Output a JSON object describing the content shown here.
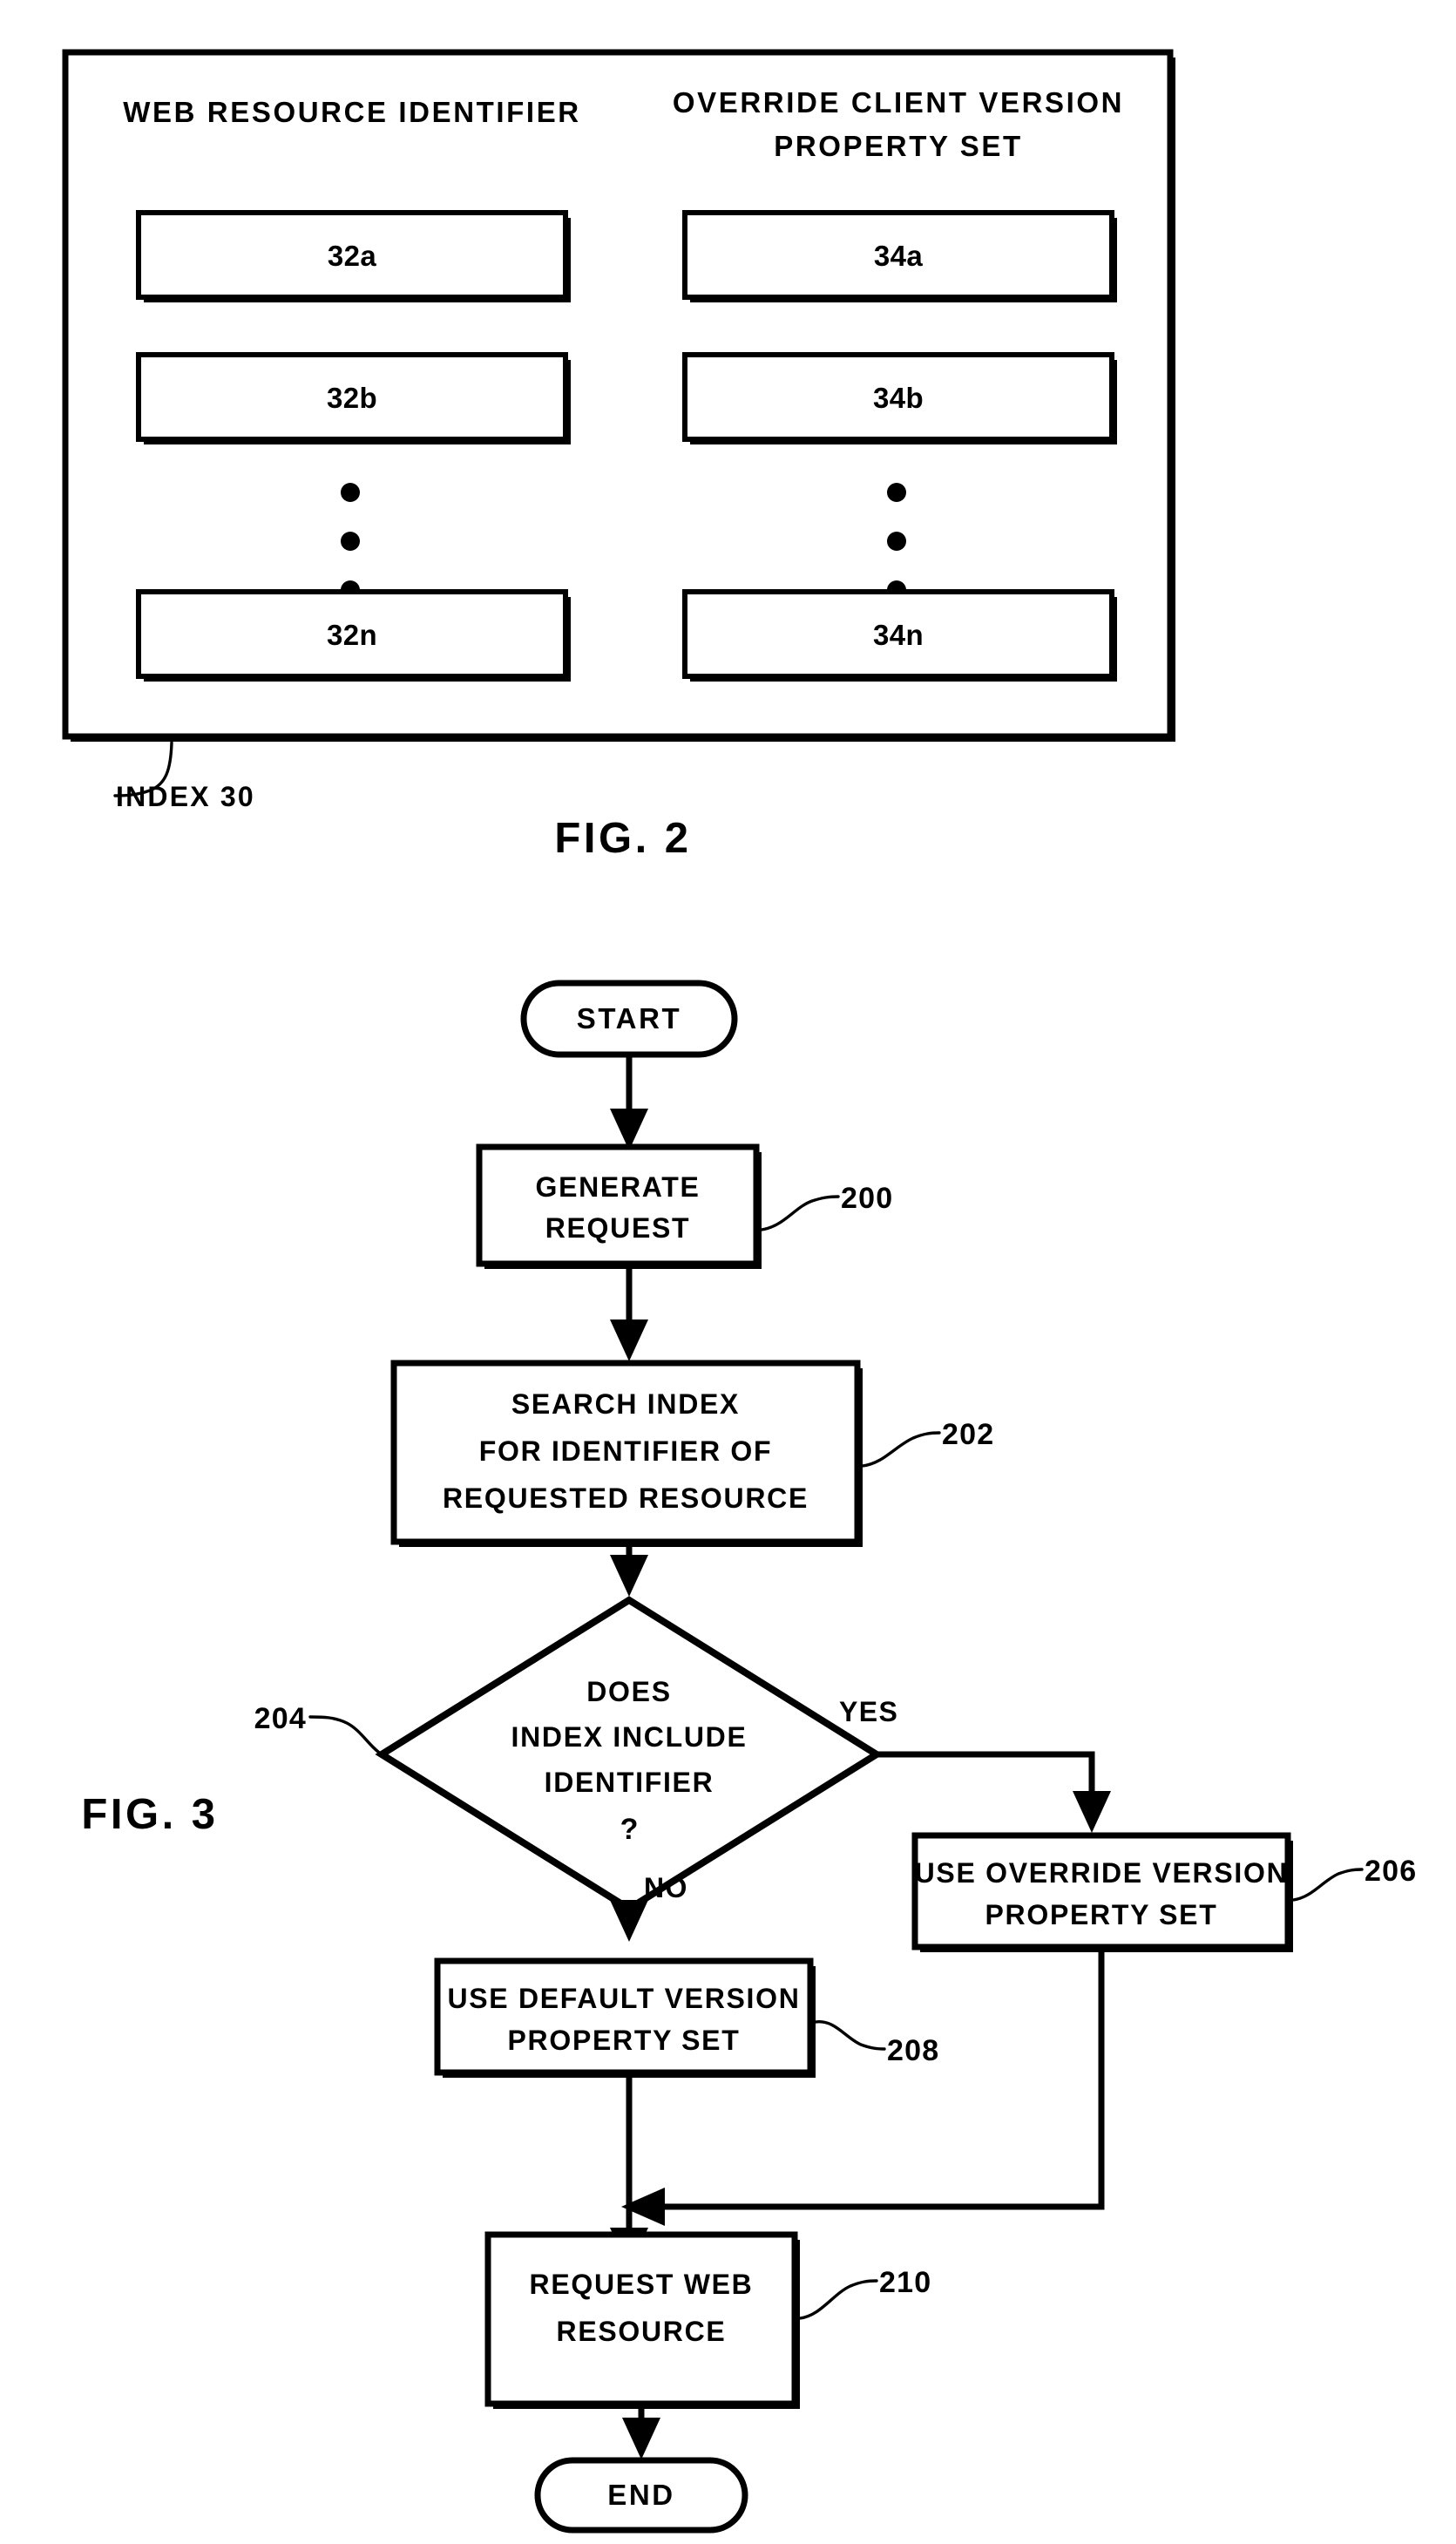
{
  "figures": [
    {
      "caption": "FIG. 2",
      "index_label": "INDEX 30",
      "columns": [
        {
          "header": "WEB RESOURCE IDENTIFIER",
          "header_lines": [
            "WEB RESOURCE IDENTIFIER"
          ],
          "cells": [
            "32a",
            "32b",
            "32n"
          ],
          "ellipsis": "vertical-three-dots"
        },
        {
          "header": "OVERRIDE CLIENT VERSION PROPERTY SET",
          "header_lines": [
            "OVERRIDE CLIENT VERSION",
            "PROPERTY SET"
          ],
          "cells": [
            "34a",
            "34b",
            "34n"
          ],
          "ellipsis": "vertical-three-dots"
        }
      ]
    },
    {
      "caption": "FIG. 3",
      "nodes": [
        {
          "id": "start",
          "shape": "terminator",
          "lines": [
            "START"
          ],
          "ref": ""
        },
        {
          "id": "n200",
          "shape": "process",
          "lines": [
            "GENERATE",
            "REQUEST"
          ],
          "ref": "200"
        },
        {
          "id": "n202",
          "shape": "process",
          "lines": [
            "SEARCH INDEX",
            "FOR IDENTIFIER OF",
            "REQUESTED RESOURCE"
          ],
          "ref": "202"
        },
        {
          "id": "n204",
          "shape": "decision",
          "lines": [
            "DOES",
            "INDEX INCLUDE",
            "IDENTIFIER",
            "?"
          ],
          "ref": "204"
        },
        {
          "id": "n206",
          "shape": "process",
          "lines": [
            "USE OVERRIDE VERSION",
            "PROPERTY SET"
          ],
          "ref": "206"
        },
        {
          "id": "n208",
          "shape": "process",
          "lines": [
            "USE DEFAULT VERSION",
            "PROPERTY SET"
          ],
          "ref": "208"
        },
        {
          "id": "n210",
          "shape": "process",
          "lines": [
            "REQUEST WEB",
            "RESOURCE"
          ],
          "ref": "210"
        },
        {
          "id": "end",
          "shape": "terminator",
          "lines": [
            "END"
          ],
          "ref": ""
        }
      ],
      "branch_labels": {
        "yes": "YES",
        "no": "NO"
      }
    }
  ],
  "fig2": {
    "caption": "FIG. 2",
    "index_label": "INDEX 30",
    "col1_header": "WEB RESOURCE IDENTIFIER",
    "col2_header_line1": "OVERRIDE CLIENT VERSION",
    "col2_header_line2": "PROPERTY SET",
    "c1r1": "32a",
    "c1r2": "32b",
    "c1r3": "32n",
    "c2r1": "34a",
    "c2r2": "34b",
    "c2r3": "34n"
  },
  "fig3": {
    "caption": "FIG. 3",
    "start": "START",
    "end": "END",
    "n200_l1": "GENERATE",
    "n200_l2": "REQUEST",
    "n200_ref": "200",
    "n202_l1": "SEARCH INDEX",
    "n202_l2": "FOR IDENTIFIER OF",
    "n202_l3": "REQUESTED RESOURCE",
    "n202_ref": "202",
    "n204_l1": "DOES",
    "n204_l2": "INDEX INCLUDE",
    "n204_l3": "IDENTIFIER",
    "n204_l4": "?",
    "n204_ref": "204",
    "n206_l1": "USE OVERRIDE VERSION",
    "n206_l2": "PROPERTY SET",
    "n206_ref": "206",
    "n208_l1": "USE DEFAULT VERSION",
    "n208_l2": "PROPERTY SET",
    "n208_ref": "208",
    "n210_l1": "REQUEST WEB",
    "n210_l2": "RESOURCE",
    "n210_ref": "210",
    "yes": "YES",
    "no": "NO"
  },
  "colors": {
    "ink": "#000000",
    "paper": "#ffffff"
  }
}
